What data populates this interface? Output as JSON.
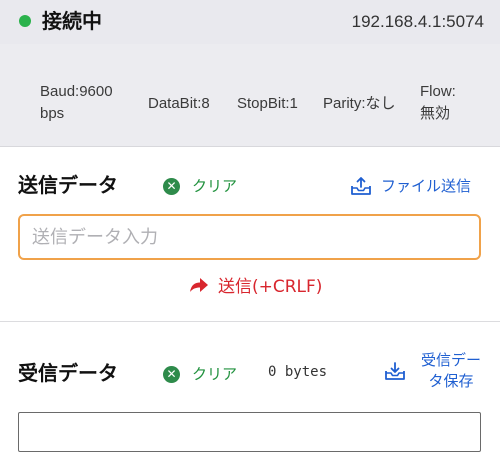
{
  "connection": {
    "status": "接続中",
    "address": "192.168.4.1:5074",
    "status_color": "#2bb24c"
  },
  "serial": {
    "baud_line1": "Baud:9600",
    "baud_line2": "bps",
    "databit": "DataBit:8",
    "stopbit": "StopBit:1",
    "parity": "Parity:なし",
    "flow_line1": "Flow:",
    "flow_line2": "無効"
  },
  "send": {
    "title": "送信データ",
    "clear_label": "クリア",
    "file_send_label": "ファイル送信",
    "input_placeholder": "送信データ入力",
    "input_value": "",
    "send_button_label": "送信(+CRLF)"
  },
  "receive": {
    "title": "受信データ",
    "clear_label": "クリア",
    "byte_count": "0 bytes",
    "save_line1": "受信デー",
    "save_line2": "タ保存"
  },
  "colors": {
    "accent_blue": "#1f5fd1",
    "clear_green": "#22923f",
    "send_red": "#d8262e",
    "input_border": "#f0a24a"
  },
  "icons": {
    "status": "green-dot-icon",
    "clear": "x-circle-icon",
    "file_send": "tray-upload-icon",
    "send": "arrow-right-icon",
    "save": "tray-download-icon"
  }
}
